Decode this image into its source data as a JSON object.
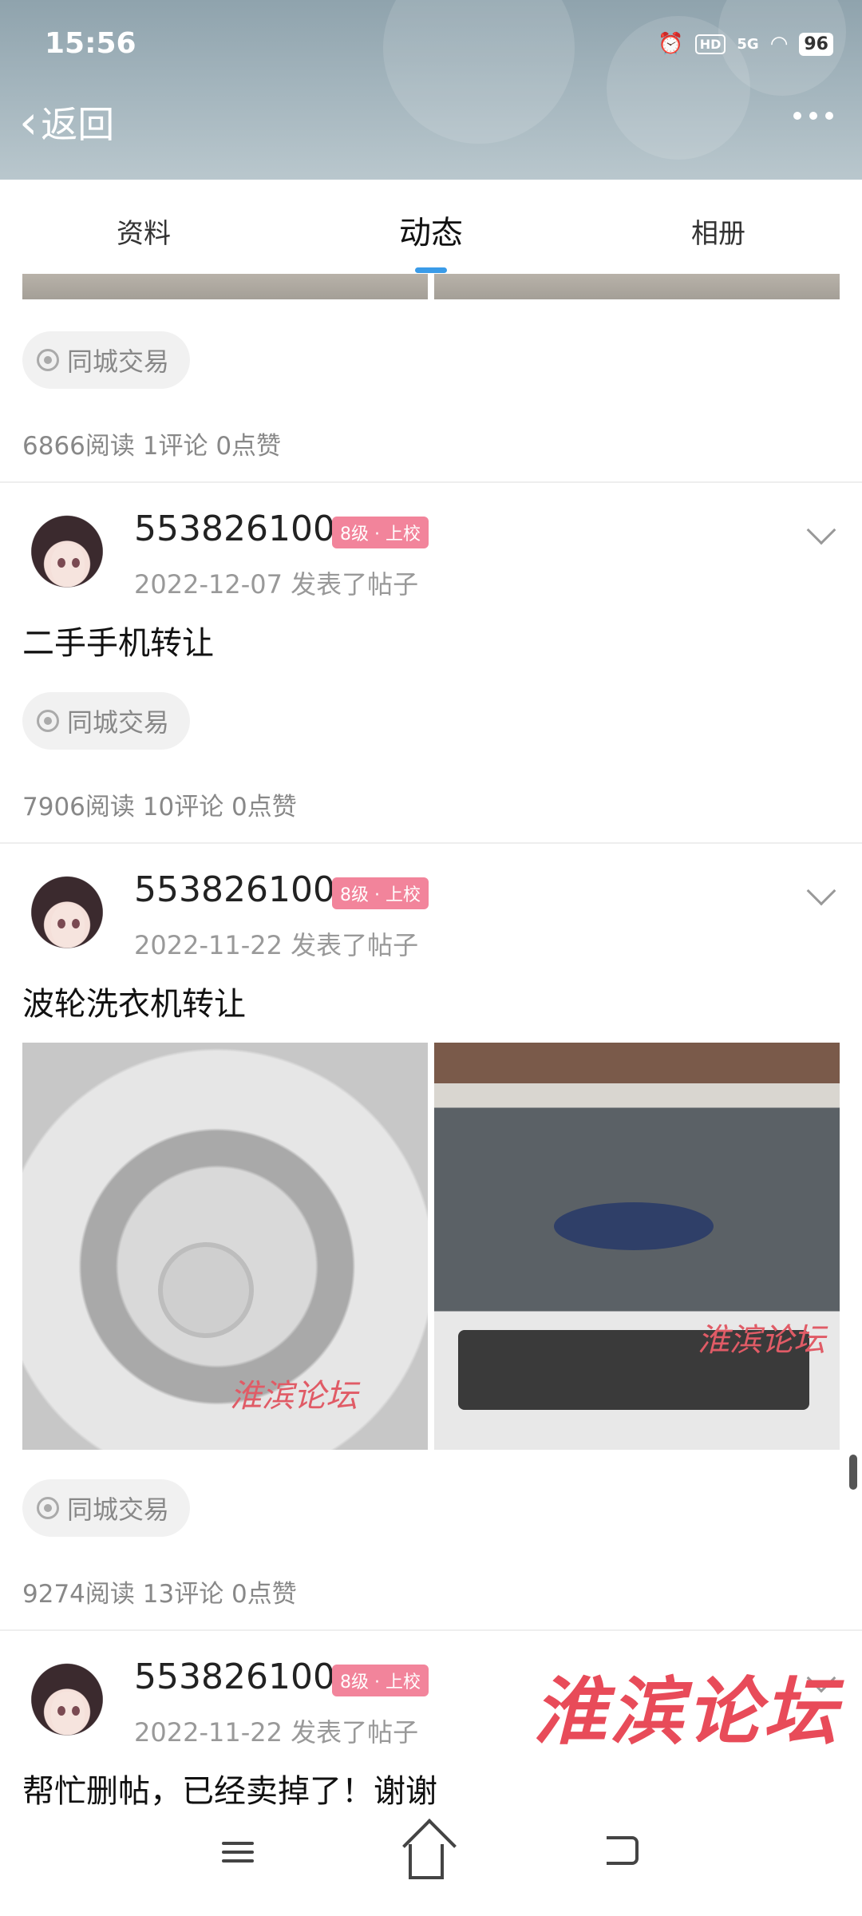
{
  "status_bar": {
    "time": "15:56",
    "battery": "96",
    "hd": "HD",
    "network": "5G"
  },
  "header": {
    "back_label": "返回"
  },
  "tabs": [
    {
      "label": "资料"
    },
    {
      "label": "动态"
    },
    {
      "label": "相册"
    }
  ],
  "posts": [
    {
      "tag": "同城交易",
      "stats": "6866阅读 1评论 0点赞"
    },
    {
      "username": "553826100",
      "level": "8级 · 上校",
      "meta": "2022-12-07  发表了帖子",
      "title": "二手手机转让",
      "tag": "同城交易",
      "stats": "7906阅读 10评论 0点赞"
    },
    {
      "username": "553826100",
      "level": "8级 · 上校",
      "meta": "2022-11-22  发表了帖子",
      "title": "波轮洗衣机转让",
      "tag": "同城交易",
      "stats": "9274阅读 13评论 0点赞"
    },
    {
      "username": "553826100",
      "level": "8级 · 上校",
      "meta": "2022-11-22  发表了帖子",
      "title": "帮忙删帖，已经卖掉了！谢谢"
    }
  ],
  "watermark": "淮滨论坛",
  "photo_watermark": "淮滨论坛"
}
